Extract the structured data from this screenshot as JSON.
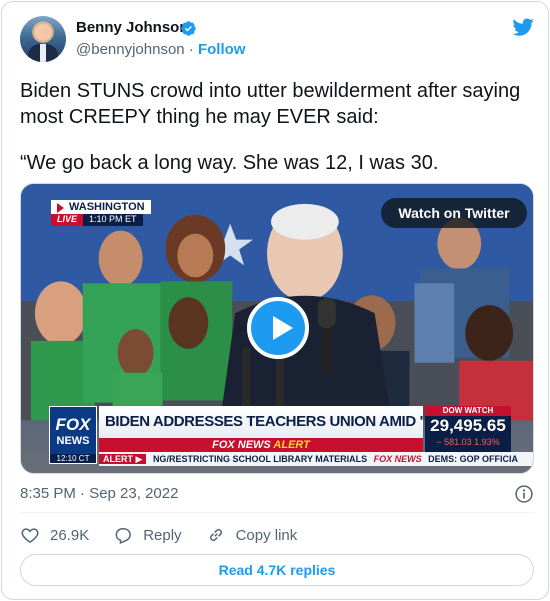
{
  "author": {
    "name": "Benny Johnson",
    "handle": "@bennyjohnson",
    "separator": "·",
    "follow_label": "Follow"
  },
  "tweet": {
    "paragraphs": [
      "Biden STUNS crowd into utter bewilderment after saying most CREEPY thing he may EVER said:",
      "“We go back a long way. She was 12, I was 30."
    ],
    "timestamp": "8:35 PM · Sep 23, 2022"
  },
  "video": {
    "watch_label": "Watch on Twitter",
    "location": "WASHINGTON",
    "live": "LIVE",
    "live_time": "1:10 PM ET",
    "fox_line1": "FOX",
    "fox_line2": "NEWS",
    "fox_clock": "12:10 CT",
    "headline": "BIDEN ADDRESSES TEACHERS UNION AMID \"WOKE\" OUTRAGE",
    "alert_brand": "FOX NEWS",
    "alert_word": "ALERT",
    "ticker_label": "ALERT ▶",
    "ticker_text": "NG/RESTRICTING SCHOOL LIBRARY MATERIALS",
    "ticker_brand": "FOX NEWS",
    "ticker_text2": "DEMS: GOP OFFICIA",
    "dow_label": "DOW WATCH",
    "dow_value": "29,495.65",
    "dow_change": "− 581.03 1.93%"
  },
  "actions": {
    "likes": "26.9K",
    "reply_label": "Reply",
    "copy_label": "Copy link"
  },
  "read_replies_label": "Read 4.7K replies",
  "colors": {
    "accent": "#1d9bf0",
    "fox_red": "#c8102e",
    "fox_navy": "#0b1f46"
  }
}
